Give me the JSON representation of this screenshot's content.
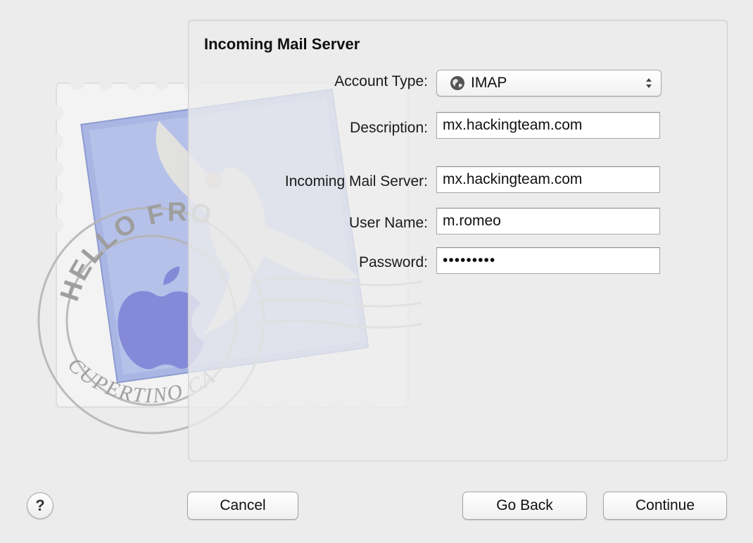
{
  "dialog": {
    "section_title": "Incoming Mail Server",
    "fields": {
      "account_type": {
        "label": "Account Type:",
        "value": "IMAP"
      },
      "description": {
        "label": "Description:",
        "value": "mx.hackingteam.com"
      },
      "incoming_server": {
        "label": "Incoming Mail Server:",
        "value": "mx.hackingteam.com"
      },
      "user_name": {
        "label": "User Name:",
        "value": "m.romeo"
      },
      "password": {
        "label": "Password:",
        "value": "•••••••••"
      }
    }
  },
  "illustration": {
    "stamp_text_top": "HELLO FROM",
    "stamp_text_bottom": "CUPERTINO CA"
  },
  "buttons": {
    "help_label": "?",
    "cancel_label": "Cancel",
    "go_back_label": "Go Back",
    "continue_label": "Continue"
  },
  "icons": {
    "account_type_icon": "globe-icon",
    "select_arrows": "updown-arrows-icon",
    "illustration": "stamp-with-hawk"
  },
  "colors": {
    "window_bg": "#ececec",
    "stamp_blue": "#aab8e6",
    "apple_logo": "#7f84d6"
  }
}
